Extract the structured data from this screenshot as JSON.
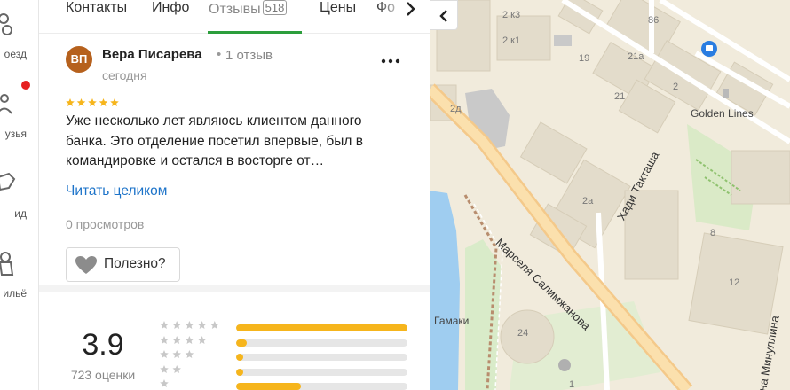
{
  "rail": {
    "items": [
      {
        "label": "оезд",
        "icon": "car-icon"
      },
      {
        "label": "узья",
        "icon": "friends-icon"
      },
      {
        "label": "ид",
        "icon": "guide-icon"
      },
      {
        "label": "ильё",
        "icon": "housing-icon"
      }
    ],
    "notification_color": "#e62020"
  },
  "tabs": {
    "items": [
      {
        "label": "Контакты"
      },
      {
        "label": "Инфо"
      },
      {
        "label": "Отзывы",
        "count": "518",
        "active": true
      },
      {
        "label": "Цены"
      },
      {
        "label": "Фо"
      }
    ],
    "accent": "#2c9e3c"
  },
  "review": {
    "initials": "ВП",
    "avatar_color": "#b6611d",
    "author": "Вера Писарева",
    "separator": "•",
    "author_reviews": "1 отзыв",
    "date": "сегодня",
    "rating": 5,
    "text": "Уже несколько лет являюсь клиентом данного банка. Это отделение посетил впервые, был в командировке и остался в восторге от…",
    "read_more": "Читать целиком",
    "views": "0 просмотров",
    "useful_label": "Полезно?"
  },
  "summary": {
    "score": "3.9",
    "count": "723 оценки",
    "bar_color": "#f6b51c",
    "distribution": [
      {
        "stars": 5,
        "fraction": 1.0
      },
      {
        "stars": 4,
        "fraction": 0.06
      },
      {
        "stars": 3,
        "fraction": 0.04
      },
      {
        "stars": 2,
        "fraction": 0.03
      },
      {
        "stars": 1,
        "fraction": 0.38
      }
    ]
  },
  "map": {
    "streets": [
      "Марселя Салимжанова",
      "Хади Такташа",
      "на Минуллина"
    ],
    "poi": [
      "Golden Lines",
      "Гамаки"
    ],
    "house_numbers": [
      "2 к3",
      "2 к1",
      "86",
      "19",
      "21а",
      "21",
      "2",
      "2д",
      "2а",
      "8",
      "12",
      "24",
      "1"
    ]
  }
}
